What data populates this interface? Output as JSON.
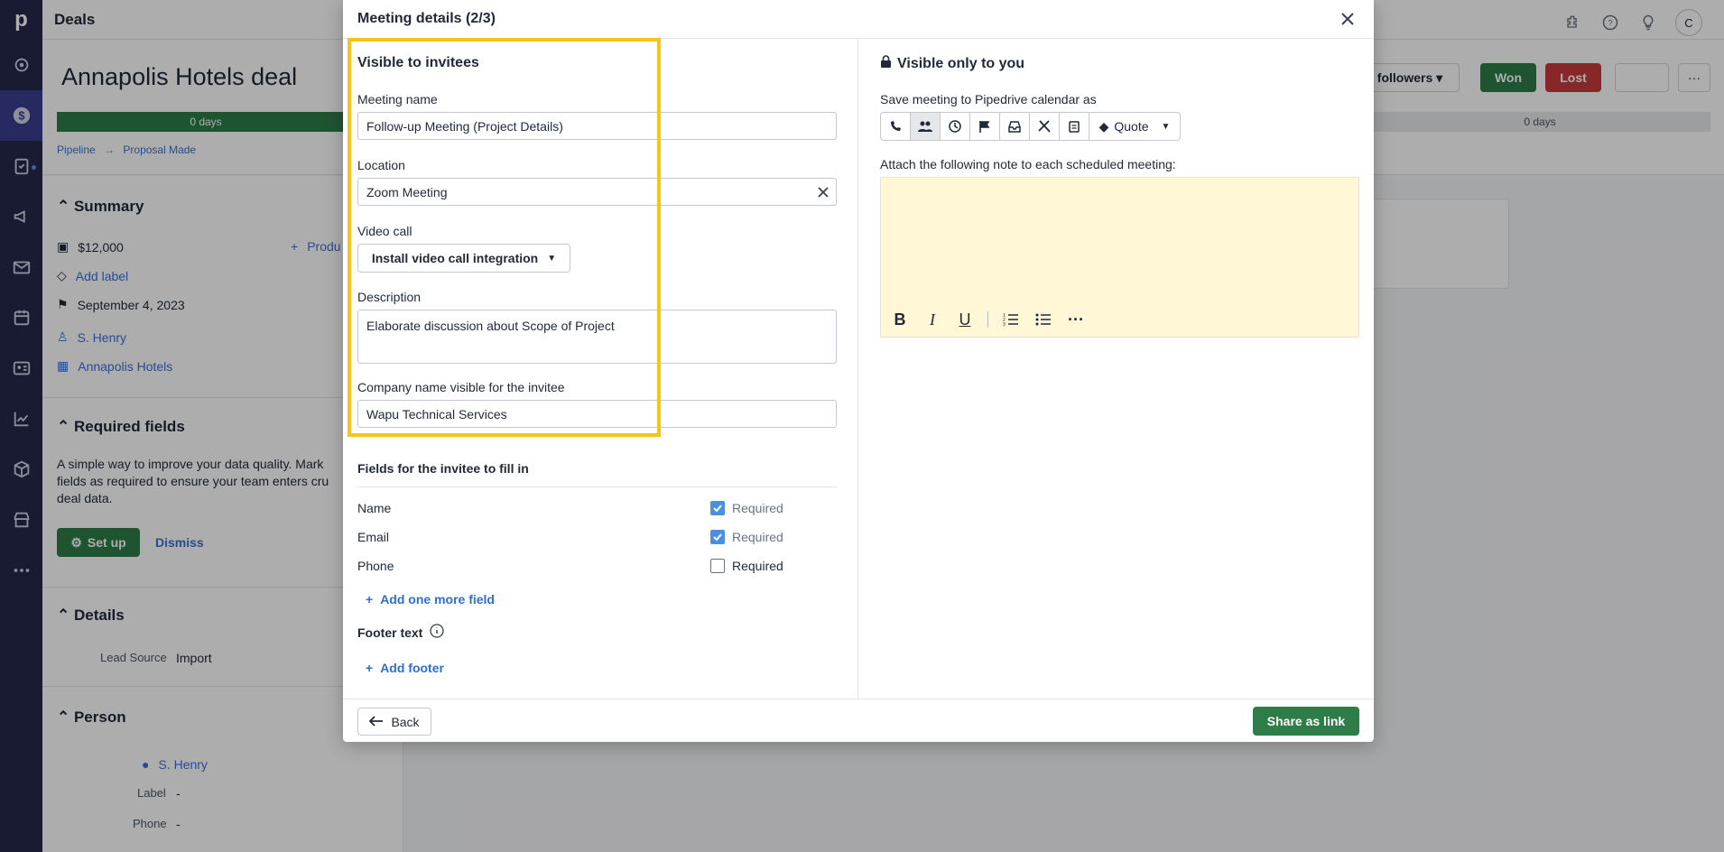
{
  "topbar": {
    "title": "Deals",
    "avatar": "C"
  },
  "deal": {
    "title": "Annapolis Hotels deal",
    "stage_left": "0 days",
    "stage_right": "0 days",
    "breadcrumb_pipeline": "Pipeline",
    "breadcrumb_stage": "Proposal Made",
    "followers": "followers",
    "won": "Won",
    "lost": "Lost"
  },
  "sidebar": {
    "summary_title": "Summary",
    "value": "$12,000",
    "products": "Produ",
    "add_label": "Add label",
    "date": "September 4, 2023",
    "person": "S. Henry",
    "org": "Annapolis Hotels",
    "required_title": "Required fields",
    "required_text": "A simple way to improve your data quality. Mark fields as required to ensure your team enters cru deal data.",
    "setup": "Set up",
    "dismiss": "Dismiss",
    "details_title": "Details",
    "lead_source_label": "Lead Source",
    "lead_source_value": "Import",
    "person_title": "Person",
    "person_name": "S. Henry",
    "label_label": "Label",
    "label_value": "-",
    "phone_label": "Phone",
    "phone_value": "-"
  },
  "modal": {
    "title": "Meeting details (2/3)",
    "left": {
      "heading": "Visible to invitees",
      "meeting_name_label": "Meeting name",
      "meeting_name_value": "Follow-up Meeting (Project Details)",
      "location_label": "Location",
      "location_value": "Zoom Meeting",
      "video_label": "Video call",
      "video_button": "Install video call integration",
      "description_label": "Description",
      "description_value": "Elaborate discussion about Scope of Project",
      "company_label": "Company name visible for the invitee",
      "company_value": "Wapu Technical Services",
      "fields_heading": "Fields for the invitee to fill in",
      "fields": [
        {
          "name": "Name",
          "required_label": "Required",
          "checked": true
        },
        {
          "name": "Email",
          "required_label": "Required",
          "checked": true
        },
        {
          "name": "Phone",
          "required_label": "Required",
          "checked": false
        }
      ],
      "add_field": "Add one more field",
      "footer_text_label": "Footer text",
      "add_footer": "Add footer"
    },
    "right": {
      "heading": "Visible only to you",
      "save_as_label": "Save meeting to Pipedrive calendar as",
      "selected_type": "Quote",
      "note_label": "Attach the following note to each scheduled meeting:"
    },
    "footer": {
      "back": "Back",
      "share": "Share as link"
    }
  },
  "colors": {
    "accent_green": "#2e7d48",
    "highlight": "#f5c518",
    "nav_bg": "#26284a",
    "link": "#3a6fd8"
  }
}
